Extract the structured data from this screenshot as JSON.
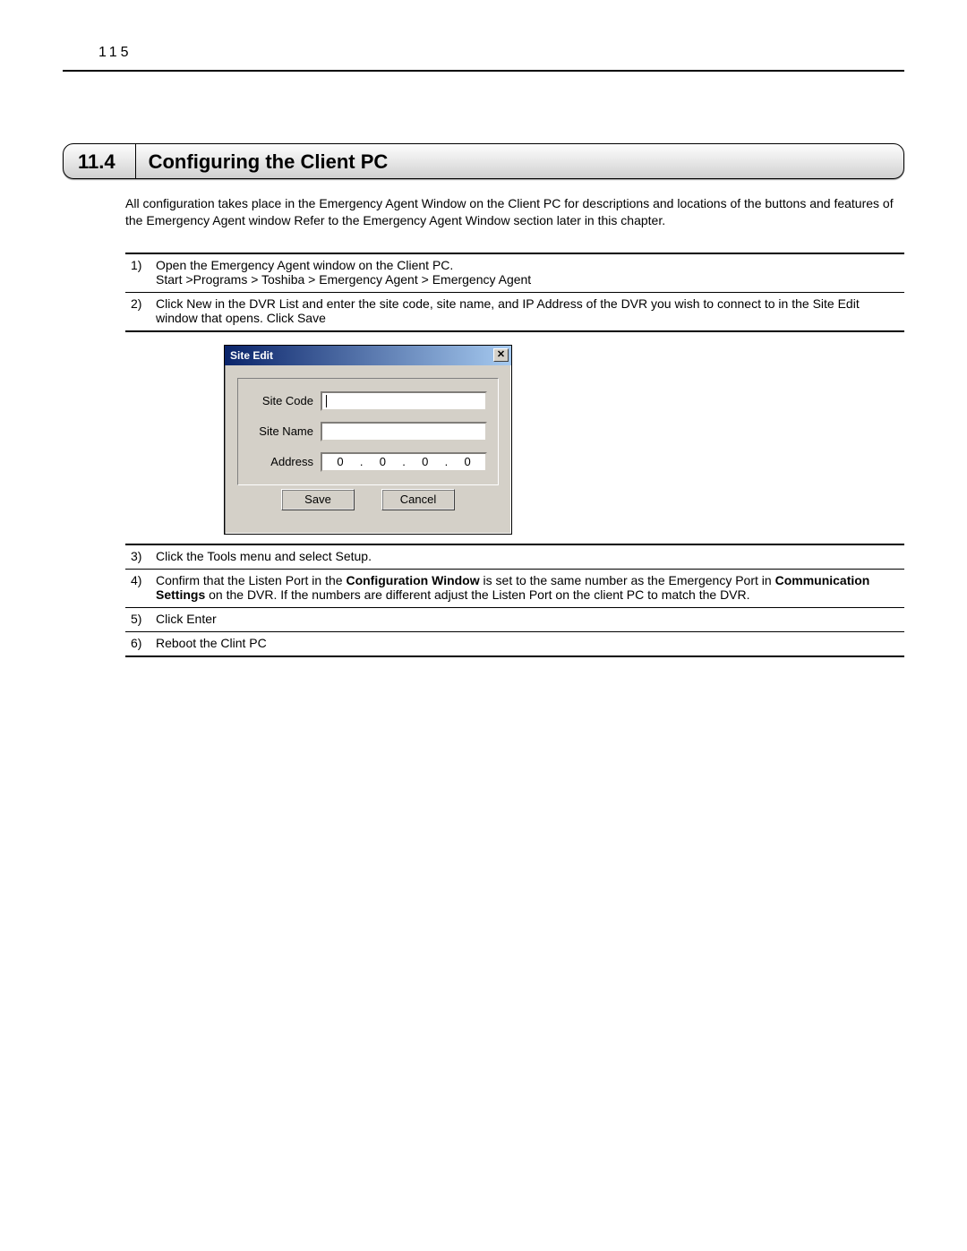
{
  "page_number": "115",
  "section": {
    "number": "11.4",
    "title": "Configuring the Client PC"
  },
  "intro": "All configuration takes place in the Emergency Agent Window on the Client PC for descriptions and locations of the buttons and features of the Emergency Agent window Refer to the Emergency Agent Window section later in this chapter.",
  "steps": {
    "s1": {
      "num": "1)",
      "line1": "Open the Emergency Agent window on the Client PC.",
      "line2": "Start >Programs > Toshiba > Emergency Agent > Emergency Agent"
    },
    "s2": {
      "num": "2)",
      "text": "Click New in the DVR List and enter the site code, site name, and IP Address of the DVR you wish to connect to in the Site Edit window that opens. Click Save"
    },
    "s3": {
      "num": "3)",
      "text": "Click the Tools menu and select Setup."
    },
    "s4": {
      "num": "4)",
      "pre": "Confirm that the Listen Port in the ",
      "b1": "Configuration Window",
      "mid": " is set to the same number as the Emergency Port in ",
      "b2": "Communication Settings",
      "post": " on the DVR. If the numbers are different adjust the Listen Port on the client PC to match the DVR."
    },
    "s5": {
      "num": "5)",
      "text": "Click Enter"
    },
    "s6": {
      "num": "6)",
      "text": "Reboot the Clint PC"
    }
  },
  "dialog": {
    "title": "Site Edit",
    "close_glyph": "✕",
    "labels": {
      "site_code": "Site Code",
      "site_name": "Site Name",
      "address": "Address"
    },
    "ip": {
      "o1": "0",
      "o2": "0",
      "o3": "0",
      "o4": "0",
      "dot": "."
    },
    "buttons": {
      "save": "Save",
      "cancel": "Cancel"
    }
  }
}
